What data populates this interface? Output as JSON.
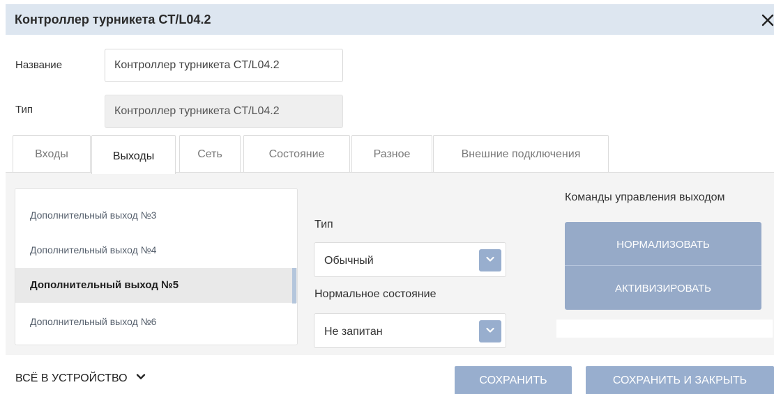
{
  "dialog": {
    "title": "Контроллер турникета CT/L04.2",
    "close_icon": "close-icon"
  },
  "fields": {
    "name_label": "Название",
    "name_value": "Контроллер турникета CT/L04.2",
    "type_label": "Тип",
    "type_value": "Контроллер турникета CT/L04.2"
  },
  "tabs": [
    {
      "label": "Входы",
      "active": false
    },
    {
      "label": "Выходы",
      "active": true
    },
    {
      "label": "Сеть",
      "active": false
    },
    {
      "label": "Состояние",
      "active": false
    },
    {
      "label": "Разное",
      "active": false
    },
    {
      "label": "Внешние подключения",
      "active": false
    }
  ],
  "outputs": [
    {
      "label": "Дополнительный выход №3",
      "selected": false
    },
    {
      "label": "Дополнительный выход №4",
      "selected": false
    },
    {
      "label": "Дополнительный выход №5",
      "selected": true
    },
    {
      "label": "Дополнительный выход №6",
      "selected": false
    }
  ],
  "settings": {
    "type_label": "Тип",
    "type_value": "Обычный",
    "normal_state_label": "Нормальное состояние",
    "normal_state_value": "Не запитан"
  },
  "commands": {
    "title": "Команды управления выходом",
    "normalize": "НОРМАЛИЗОВАТЬ",
    "activate": "АКТИВИЗИРОВАТЬ"
  },
  "footer": {
    "all_to_device": "ВСЁ В УСТРОЙСТВО",
    "save": "СОХРАНИТЬ",
    "save_close": "СОХРАНИТЬ И ЗАКРЫТЬ"
  },
  "colors": {
    "header_bg": "#dde6f0",
    "accent_button": "#98aece",
    "body_bg": "#f4f4f4",
    "selected_row": "#e9e9e9"
  }
}
